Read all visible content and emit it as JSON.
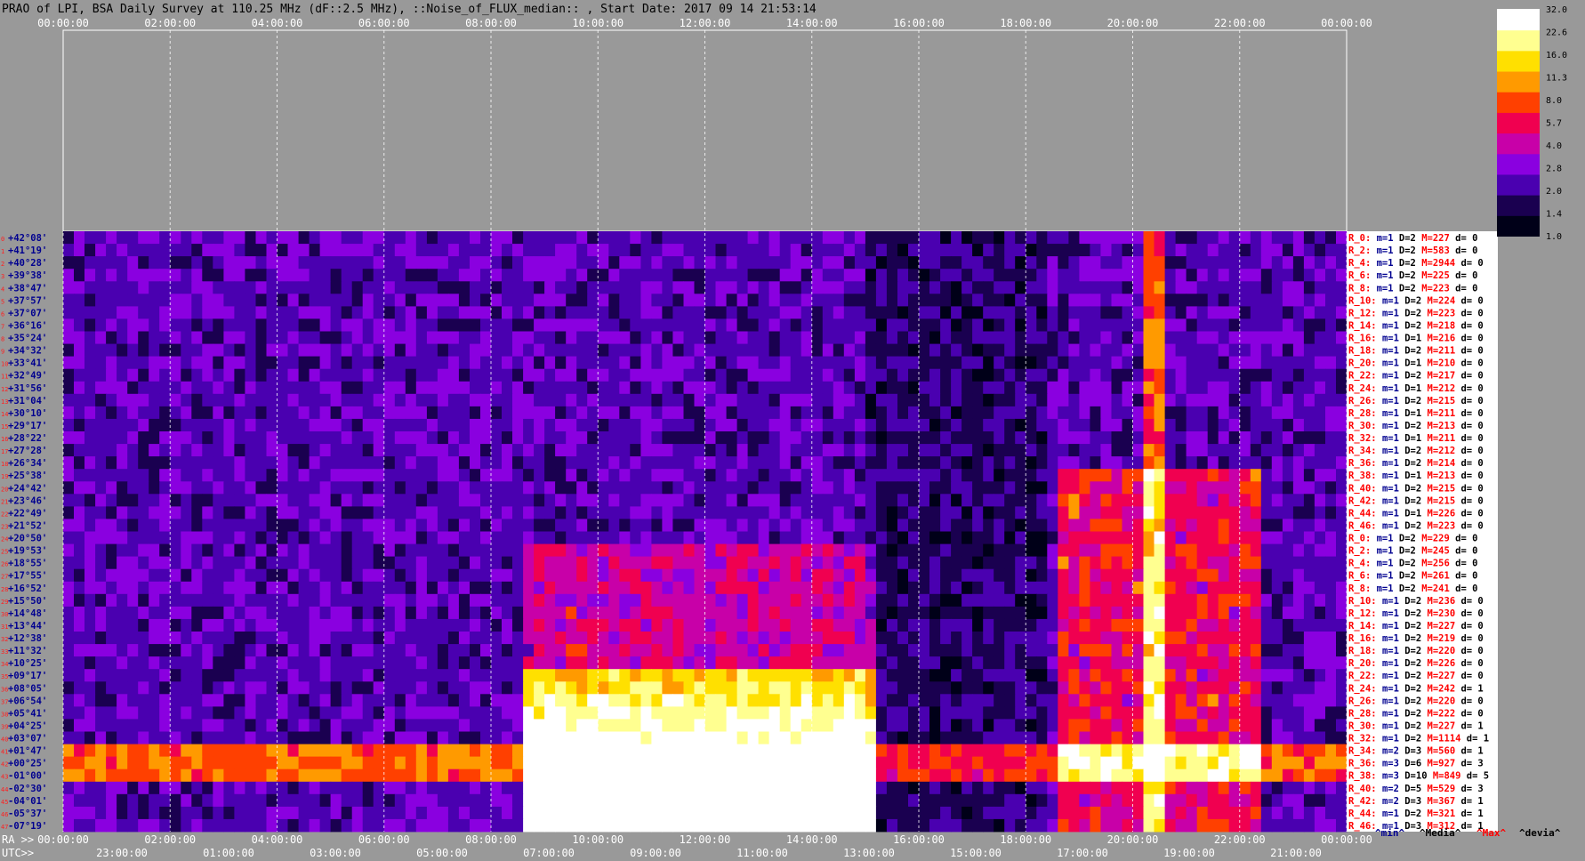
{
  "header": {
    "title": "PRAO of LPI, BSA Daily Survey at 110.25 MHz (dF::2.5 MHz), ::Noise_of_FLUX_median:: , Start Date: 2017 09 14 21:53:14"
  },
  "colorbar": {
    "ticks": [
      "32.0",
      "22.6",
      "16.0",
      "11.3",
      "8.0",
      "5.7",
      "4.0",
      "2.8",
      "2.0",
      "1.4",
      "1.0"
    ],
    "colors": [
      "#000018",
      "#1a0050",
      "#4a00b0",
      "#8a00e0",
      "#c800a8",
      "#f00050",
      "#ff4000",
      "#ff9a00",
      "#ffe000",
      "#ffff90",
      "#ffffff"
    ]
  },
  "chart_data": {
    "type": "heatmap",
    "title": "PRAO of LPI, BSA Daily Survey at 110.25 MHz (dF::2.5 MHz), ::Noise_of_FLUX_median:: , Start Date: 2017 09 14 21:53:14",
    "top_axis_labels": [
      "00:00:00",
      "02:00:00",
      "04:00:00",
      "06:00:00",
      "08:00:00",
      "10:00:00",
      "12:00:00",
      "14:00:00",
      "16:00:00",
      "18:00:00",
      "20:00:00",
      "22:00:00",
      "00:00:00"
    ],
    "ra_axis": {
      "prefix": "RA >>",
      "labels": [
        "00:00:00",
        "02:00:00",
        "04:00:00",
        "06:00:00",
        "08:00:00",
        "10:00:00",
        "12:00:00",
        "14:00:00",
        "16:00:00",
        "18:00:00",
        "20:00:00",
        "22:00:00",
        "00:00:00"
      ]
    },
    "utc_axis": {
      "prefix": "UTC>>",
      "labels": [
        "23:00:00",
        "01:00:00",
        "03:00:00",
        "05:00:00",
        "07:00:00",
        "09:00:00",
        "11:00:00",
        "13:00:00",
        "15:00:00",
        "17:00:00",
        "19:00:00",
        "21:00:00"
      ]
    },
    "declination_labels": [
      "+42°08'",
      "+41°19'",
      "+40°28'",
      "+39°38'",
      "+38°47'",
      "+37°57'",
      "+37°07'",
      "+36°16'",
      "+35°24'",
      "+34°32'",
      "+33°41'",
      "+32°49'",
      "+31°56'",
      "+31°04'",
      "+30°10'",
      "+29°17'",
      "+28°22'",
      "+27°28'",
      "+26°34'",
      "+25°38'",
      "+24°42'",
      "+23°46'",
      "+22°49'",
      "+21°52'",
      "+20°50'",
      "+19°53'",
      "+18°55'",
      "+17°55'",
      "+16°52'",
      "+15°50'",
      "+14°48'",
      "+13°44'",
      "+12°38'",
      "+11°32'",
      "+10°25'",
      "+09°17'",
      "+08°05'",
      "+06°54'",
      "+05°41'",
      "+04°25'",
      "+03°07'",
      "+01°47'",
      "+00°25'",
      "-01°00'",
      "-02°30'",
      "-04°01'",
      "-05°37'",
      "-07°19'"
    ],
    "beam_stats": [
      {
        "r": "R_0:",
        "m": "1",
        "d": "2",
        "max": "227",
        "dev": "0"
      },
      {
        "r": "R_2:",
        "m": "1",
        "d": "2",
        "max": "583",
        "dev": "0"
      },
      {
        "r": "R_4:",
        "m": "1",
        "d": "2",
        "max": "2944",
        "dev": "0"
      },
      {
        "r": "R_6:",
        "m": "1",
        "d": "2",
        "max": "225",
        "dev": "0"
      },
      {
        "r": "R_8:",
        "m": "1",
        "d": "2",
        "max": "223",
        "dev": "0"
      },
      {
        "r": "R_10:",
        "m": "1",
        "d": "2",
        "max": "224",
        "dev": "0"
      },
      {
        "r": "R_12:",
        "m": "1",
        "d": "2",
        "max": "223",
        "dev": "0"
      },
      {
        "r": "R_14:",
        "m": "1",
        "d": "2",
        "max": "218",
        "dev": "0"
      },
      {
        "r": "R_16:",
        "m": "1",
        "d": "1",
        "max": "216",
        "dev": "0"
      },
      {
        "r": "R_18:",
        "m": "1",
        "d": "2",
        "max": "211",
        "dev": "0"
      },
      {
        "r": "R_20:",
        "m": "1",
        "d": "1",
        "max": "210",
        "dev": "0"
      },
      {
        "r": "R_22:",
        "m": "1",
        "d": "2",
        "max": "217",
        "dev": "0"
      },
      {
        "r": "R_24:",
        "m": "1",
        "d": "1",
        "max": "212",
        "dev": "0"
      },
      {
        "r": "R_26:",
        "m": "1",
        "d": "2",
        "max": "215",
        "dev": "0"
      },
      {
        "r": "R_28:",
        "m": "1",
        "d": "1",
        "max": "211",
        "dev": "0"
      },
      {
        "r": "R_30:",
        "m": "1",
        "d": "2",
        "max": "213",
        "dev": "0"
      },
      {
        "r": "R_32:",
        "m": "1",
        "d": "1",
        "max": "211",
        "dev": "0"
      },
      {
        "r": "R_34:",
        "m": "1",
        "d": "2",
        "max": "212",
        "dev": "0"
      },
      {
        "r": "R_36:",
        "m": "1",
        "d": "2",
        "max": "214",
        "dev": "0"
      },
      {
        "r": "R_38:",
        "m": "1",
        "d": "1",
        "max": "213",
        "dev": "0"
      },
      {
        "r": "R_40:",
        "m": "1",
        "d": "2",
        "max": "215",
        "dev": "0"
      },
      {
        "r": "R_42:",
        "m": "1",
        "d": "2",
        "max": "215",
        "dev": "0"
      },
      {
        "r": "R_44:",
        "m": "1",
        "d": "1",
        "max": "226",
        "dev": "0"
      },
      {
        "r": "R_46:",
        "m": "1",
        "d": "2",
        "max": "223",
        "dev": "0"
      },
      {
        "r": "R_0:",
        "m": "1",
        "d": "2",
        "max": "229",
        "dev": "0"
      },
      {
        "r": "R_2:",
        "m": "1",
        "d": "2",
        "max": "245",
        "dev": "0"
      },
      {
        "r": "R_4:",
        "m": "1",
        "d": "2",
        "max": "256",
        "dev": "0"
      },
      {
        "r": "R_6:",
        "m": "1",
        "d": "2",
        "max": "261",
        "dev": "0"
      },
      {
        "r": "R_8:",
        "m": "1",
        "d": "2",
        "max": "241",
        "dev": "0"
      },
      {
        "r": "R_10:",
        "m": "1",
        "d": "2",
        "max": "236",
        "dev": "0"
      },
      {
        "r": "R_12:",
        "m": "1",
        "d": "2",
        "max": "230",
        "dev": "0"
      },
      {
        "r": "R_14:",
        "m": "1",
        "d": "2",
        "max": "227",
        "dev": "0"
      },
      {
        "r": "R_16:",
        "m": "1",
        "d": "2",
        "max": "219",
        "dev": "0"
      },
      {
        "r": "R_18:",
        "m": "1",
        "d": "2",
        "max": "220",
        "dev": "0"
      },
      {
        "r": "R_20:",
        "m": "1",
        "d": "2",
        "max": "226",
        "dev": "0"
      },
      {
        "r": "R_22:",
        "m": "1",
        "d": "2",
        "max": "227",
        "dev": "0"
      },
      {
        "r": "R_24:",
        "m": "1",
        "d": "2",
        "max": "242",
        "dev": "1"
      },
      {
        "r": "R_26:",
        "m": "1",
        "d": "2",
        "max": "220",
        "dev": "0"
      },
      {
        "r": "R_28:",
        "m": "1",
        "d": "2",
        "max": "222",
        "dev": "0"
      },
      {
        "r": "R_30:",
        "m": "1",
        "d": "2",
        "max": "227",
        "dev": "1"
      },
      {
        "r": "R_32:",
        "m": "1",
        "d": "2",
        "max": "1114",
        "dev": "1"
      },
      {
        "r": "R_34:",
        "m": "2",
        "d": "3",
        "max": "560",
        "dev": "1"
      },
      {
        "r": "R_36:",
        "m": "3",
        "d": "6",
        "max": "927",
        "dev": "3"
      },
      {
        "r": "R_38:",
        "m": "3",
        "d": "10",
        "max": "849",
        "dev": "5"
      },
      {
        "r": "R_40:",
        "m": "2",
        "d": "5",
        "max": "529",
        "dev": "3"
      },
      {
        "r": "R_42:",
        "m": "2",
        "d": "3",
        "max": "367",
        "dev": "1"
      },
      {
        "r": "R_44:",
        "m": "1",
        "d": "2",
        "max": "321",
        "dev": "1"
      },
      {
        "r": "R_46:",
        "m": "1",
        "d": "3",
        "max": "312",
        "dev": "1"
      }
    ],
    "stats_legend": [
      "^min^",
      "^Media^",
      "^Max^",
      "^devia^"
    ],
    "stats_legend_colors": [
      "#000090",
      "#000000",
      "#ff0000",
      "#000000"
    ]
  }
}
